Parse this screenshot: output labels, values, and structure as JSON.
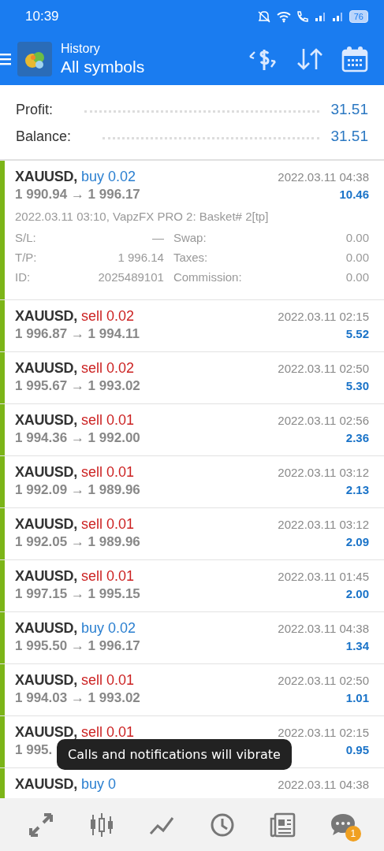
{
  "status_bar": {
    "time": "10:39",
    "battery": "76"
  },
  "toolbar": {
    "title": "History",
    "subtitle": "All symbols"
  },
  "summary": [
    {
      "label": "Profit:",
      "value": "31.51"
    },
    {
      "label": "Balance:",
      "value": "31.51"
    }
  ],
  "deals": [
    {
      "symbol": "XAUUSD,",
      "kind": "buy",
      "volume": "buy 0.02",
      "prices": "1 990.94 → 1 996.17",
      "time": "2022.03.11 04:38",
      "profit": "10.46",
      "expanded": true,
      "comment": "2022.03.11 03:10, VapzFX PRO 2: Basket# 2[tp]",
      "details": [
        {
          "label": "S/L:",
          "value": "—",
          "label2": "Swap:",
          "value2": "0.00"
        },
        {
          "label": "T/P:",
          "value": "1 996.14",
          "label2": "Taxes:",
          "value2": "0.00"
        },
        {
          "label": "ID:",
          "value": "2025489101",
          "label2": "Commission:",
          "value2": "0.00"
        }
      ]
    },
    {
      "symbol": "XAUUSD,",
      "kind": "sell",
      "volume": "sell 0.02",
      "prices": "1 996.87 → 1 994.11",
      "time": "2022.03.11 02:15",
      "profit": "5.52",
      "expanded": false
    },
    {
      "symbol": "XAUUSD,",
      "kind": "sell",
      "volume": "sell 0.02",
      "prices": "1 995.67 → 1 993.02",
      "time": "2022.03.11 02:50",
      "profit": "5.30",
      "expanded": false
    },
    {
      "symbol": "XAUUSD,",
      "kind": "sell",
      "volume": "sell 0.01",
      "prices": "1 994.36 → 1 992.00",
      "time": "2022.03.11 02:56",
      "profit": "2.36",
      "expanded": false
    },
    {
      "symbol": "XAUUSD,",
      "kind": "sell",
      "volume": "sell 0.01",
      "prices": "1 992.09 → 1 989.96",
      "time": "2022.03.11 03:12",
      "profit": "2.13",
      "expanded": false
    },
    {
      "symbol": "XAUUSD,",
      "kind": "sell",
      "volume": "sell 0.01",
      "prices": "1 992.05 → 1 989.96",
      "time": "2022.03.11 03:12",
      "profit": "2.09",
      "expanded": false
    },
    {
      "symbol": "XAUUSD,",
      "kind": "sell",
      "volume": "sell 0.01",
      "prices": "1 997.15 → 1 995.15",
      "time": "2022.03.11 01:45",
      "profit": "2.00",
      "expanded": false
    },
    {
      "symbol": "XAUUSD,",
      "kind": "buy",
      "volume": "buy 0.02",
      "prices": "1 995.50 → 1 996.17",
      "time": "2022.03.11 04:38",
      "profit": "1.34",
      "expanded": false
    },
    {
      "symbol": "XAUUSD,",
      "kind": "sell",
      "volume": "sell 0.01",
      "prices": "1 994.03 → 1 993.02",
      "time": "2022.03.11 02:50",
      "profit": "1.01",
      "expanded": false
    },
    {
      "symbol": "XAUUSD,",
      "kind": "sell",
      "volume": "sell 0.01",
      "prices": "1 995.",
      "time": "2022.03.11 02:15",
      "profit": "0.95",
      "expanded": false
    },
    {
      "symbol": "XAUUSD,",
      "kind": "buy",
      "volume": "buy 0",
      "time": "2022.03.11 04:38",
      "expanded": false
    }
  ],
  "toast": "Calls and notifications will vibrate",
  "bottom_nav": [
    {
      "kind": "quotes"
    },
    {
      "kind": "chart"
    },
    {
      "kind": "trade"
    },
    {
      "kind": "history"
    },
    {
      "kind": "news"
    },
    {
      "kind": "chat",
      "badge": "1"
    }
  ]
}
